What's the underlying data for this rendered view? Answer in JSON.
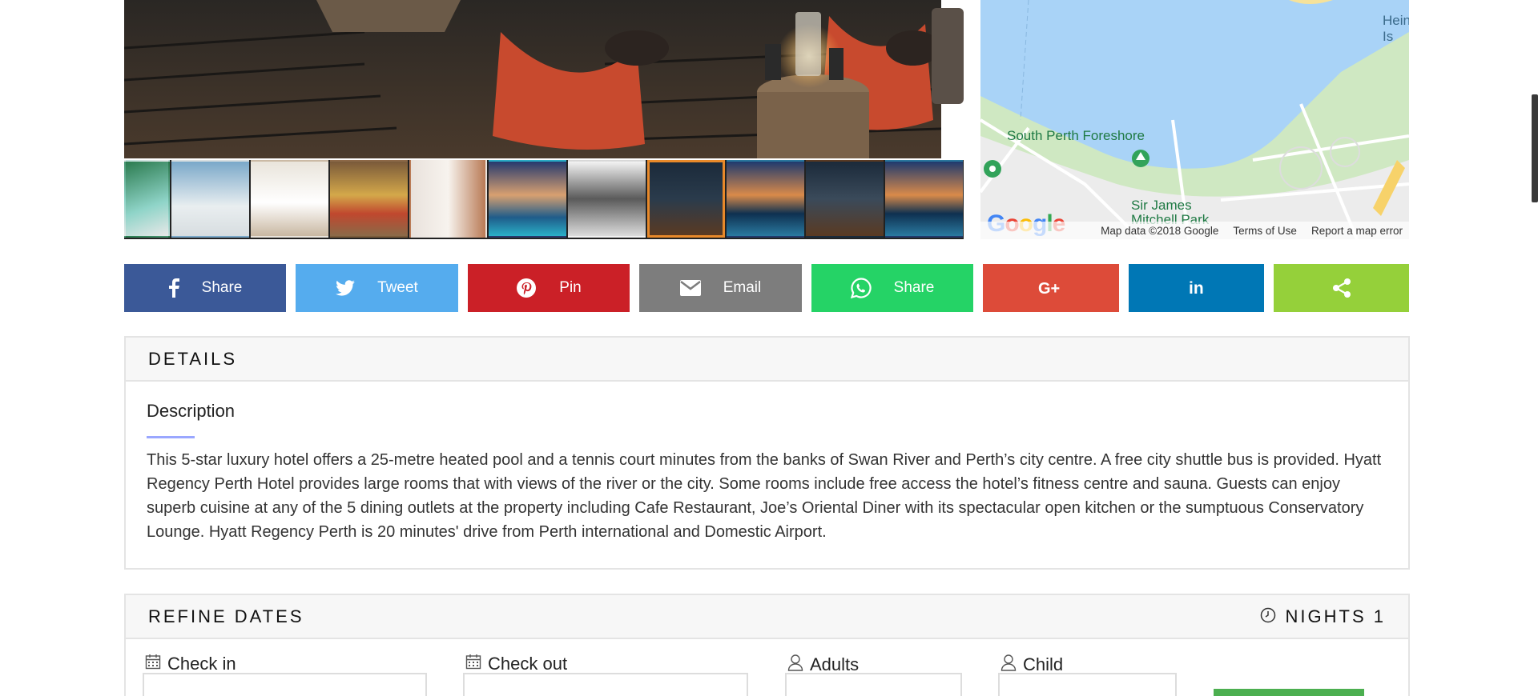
{
  "gallery": {
    "thumb_count": 11,
    "active_index": 7
  },
  "map": {
    "labels": {
      "place_1": "South Perth Foreshore",
      "place_2": "Sir James\nMitchell Park",
      "place_3": "Hein\nIs"
    },
    "google_logo": "Google",
    "footer": {
      "map_data": "Map data ©2018 Google",
      "terms": "Terms of Use",
      "report": "Report a map error"
    }
  },
  "share": [
    {
      "network": "facebook",
      "label": "Share",
      "color": "#3b5998",
      "icon": "facebook-icon"
    },
    {
      "network": "twitter",
      "label": "Tweet",
      "color": "#55acee",
      "icon": "twitter-icon"
    },
    {
      "network": "pinterest",
      "label": "Pin",
      "color": "#cb2027",
      "icon": "pinterest-icon"
    },
    {
      "network": "email",
      "label": "Email",
      "color": "#7d7d7d",
      "icon": "email-icon"
    },
    {
      "network": "whatsapp",
      "label": "Share",
      "color": "#25d366",
      "icon": "whatsapp-icon"
    },
    {
      "network": "googleplus",
      "label": "",
      "color": "#dd4b39",
      "icon": "google-plus-icon"
    },
    {
      "network": "linkedin",
      "label": "",
      "color": "#0077b5",
      "icon": "linkedin-icon"
    },
    {
      "network": "sharethis",
      "label": "",
      "color": "#95d03a",
      "icon": "share-icon"
    }
  ],
  "details": {
    "heading": "DETAILS",
    "description_title": "Description",
    "description": "This 5-star luxury hotel offers a 25-metre heated pool and a tennis court minutes from the banks of Swan River and Perth’s city centre. A free city shuttle bus is provided. Hyatt Regency Perth Hotel provides large rooms that with views of the river or the city. Some rooms include free access the hotel’s fitness centre and sauna. Guests can enjoy superb cuisine at any of the 5 dining outlets at the property including Cafe Restaurant, Joe’s Oriental Diner with its spectacular open kitchen or the sumptuous Conservatory Lounge. Hyatt Regency Perth is 20 minutes' drive from Perth international and Domestic Airport."
  },
  "refine": {
    "heading": "REFINE DATES",
    "nights_label": "NIGHTS 1",
    "fields": {
      "check_in": "Check in",
      "check_out": "Check out",
      "adults": "Adults",
      "child": "Child"
    }
  }
}
